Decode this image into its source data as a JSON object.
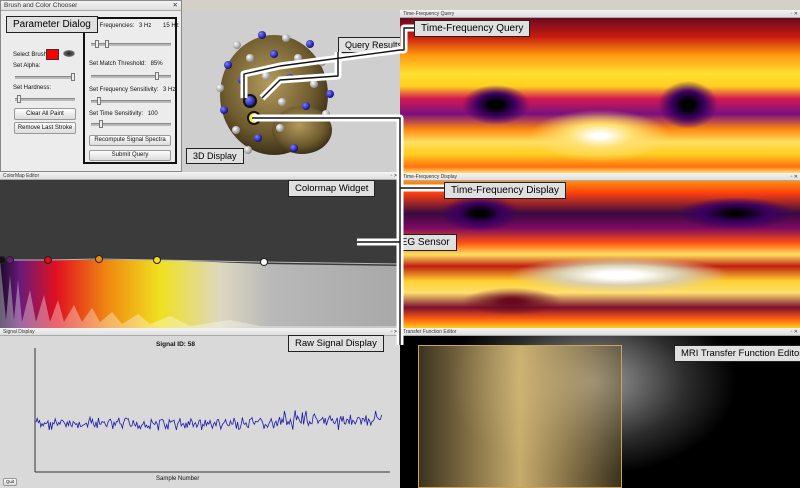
{
  "brush_window": {
    "title": "Brush and Color Chooser",
    "callout": "Parameter Dialog",
    "select_brush_label": "Select Brush",
    "brush_color": "#ff0000",
    "alpha_label": "Set Alpha:",
    "hardness_label": "Set Hardness:",
    "clear_button": "Clear All Paint",
    "remove_button": "Remove Last Stroke"
  },
  "query_params": {
    "freq_label": "Set Frequencies:",
    "freq_low": "3 Hz",
    "freq_high": "15 Hz",
    "match_label": "Set Match Threshold:",
    "match_value": "85%",
    "freq_sens_label": "Set Frequency Sensitivity:",
    "freq_sens_value": "3 Hz",
    "time_sens_label": "Set Time Sensitivity:",
    "time_sens_value": "100",
    "recompute_button": "Recompute Signal Spectra",
    "submit_button": "Submit Query"
  },
  "display3d": {
    "callout": "3D Display",
    "query_results_callout": "Query Results"
  },
  "tf_query": {
    "title": "Time-Frequency Query",
    "callout": "Time-Frequency Query"
  },
  "tf_display": {
    "title": "Time-Frequency Display",
    "callout": "Time-Frequency Display",
    "active_sensor_callout": "Active EEG Sensor"
  },
  "colormap": {
    "title": "ColorMap Editor",
    "callout": "Colormap Widget",
    "control_points": [
      {
        "color": "#111111"
      },
      {
        "color": "#6a1a7a"
      },
      {
        "color": "#e01010"
      },
      {
        "color": "#f08a10"
      },
      {
        "color": "#f0e020"
      },
      {
        "color": "#ffffff"
      }
    ]
  },
  "signal": {
    "title": "Signal Display",
    "callout": "Raw Signal Display",
    "signal_id": "Signal ID: 58",
    "xlabel": "Sample Number",
    "quit_button": "Quit",
    "line_color": "#1a1aa8"
  },
  "mri": {
    "title": "Transfer Function Editor",
    "callout": "MRI Transfer Function Editor"
  }
}
